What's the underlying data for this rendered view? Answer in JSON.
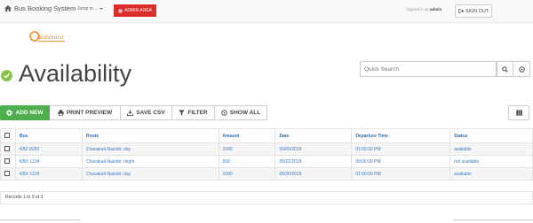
{
  "navbar": {
    "brand": "Bus Booking System",
    "jump": "Jump to ...",
    "admin_area": "ADMIN AREA",
    "signed_in_prefix": "Signed in as",
    "signed_in_user": "admin",
    "sign_out": "SIGN OUT"
  },
  "logo": {
    "text": "kashimira"
  },
  "page": {
    "title": "Availability"
  },
  "search": {
    "placeholder": "Quick Search"
  },
  "toolbar": {
    "add_new": "ADD NEW",
    "print_preview": "PRINT PREVIEW",
    "save_csv": "SAVE CSV",
    "filter": "FILTER",
    "show_all": "SHOW ALL"
  },
  "table": {
    "headers": [
      "Bus",
      "Route",
      "Amount",
      "Date",
      "Departure Time",
      "Status"
    ],
    "rows": [
      [
        "KBZ 8283",
        "Chavakali-Nairobi: day",
        "1000",
        "06/05/2018",
        "01:00:00 PM",
        "available"
      ],
      [
        "KBX 1234",
        "Chavakali-Nairobi: might",
        "500",
        "05/22/2018",
        "08:00:00 PM",
        "not available"
      ],
      [
        "KBX 1234",
        "Chavakali-Nairobi: day",
        "1000",
        "05/20/2018",
        "01:00:00 PM",
        "available"
      ]
    ]
  },
  "records": "Records 1 to 3 of 3",
  "colors": {
    "accent_red": "#dd2c2c",
    "accent_green": "#4cae4c",
    "link_blue": "#3878c6"
  }
}
